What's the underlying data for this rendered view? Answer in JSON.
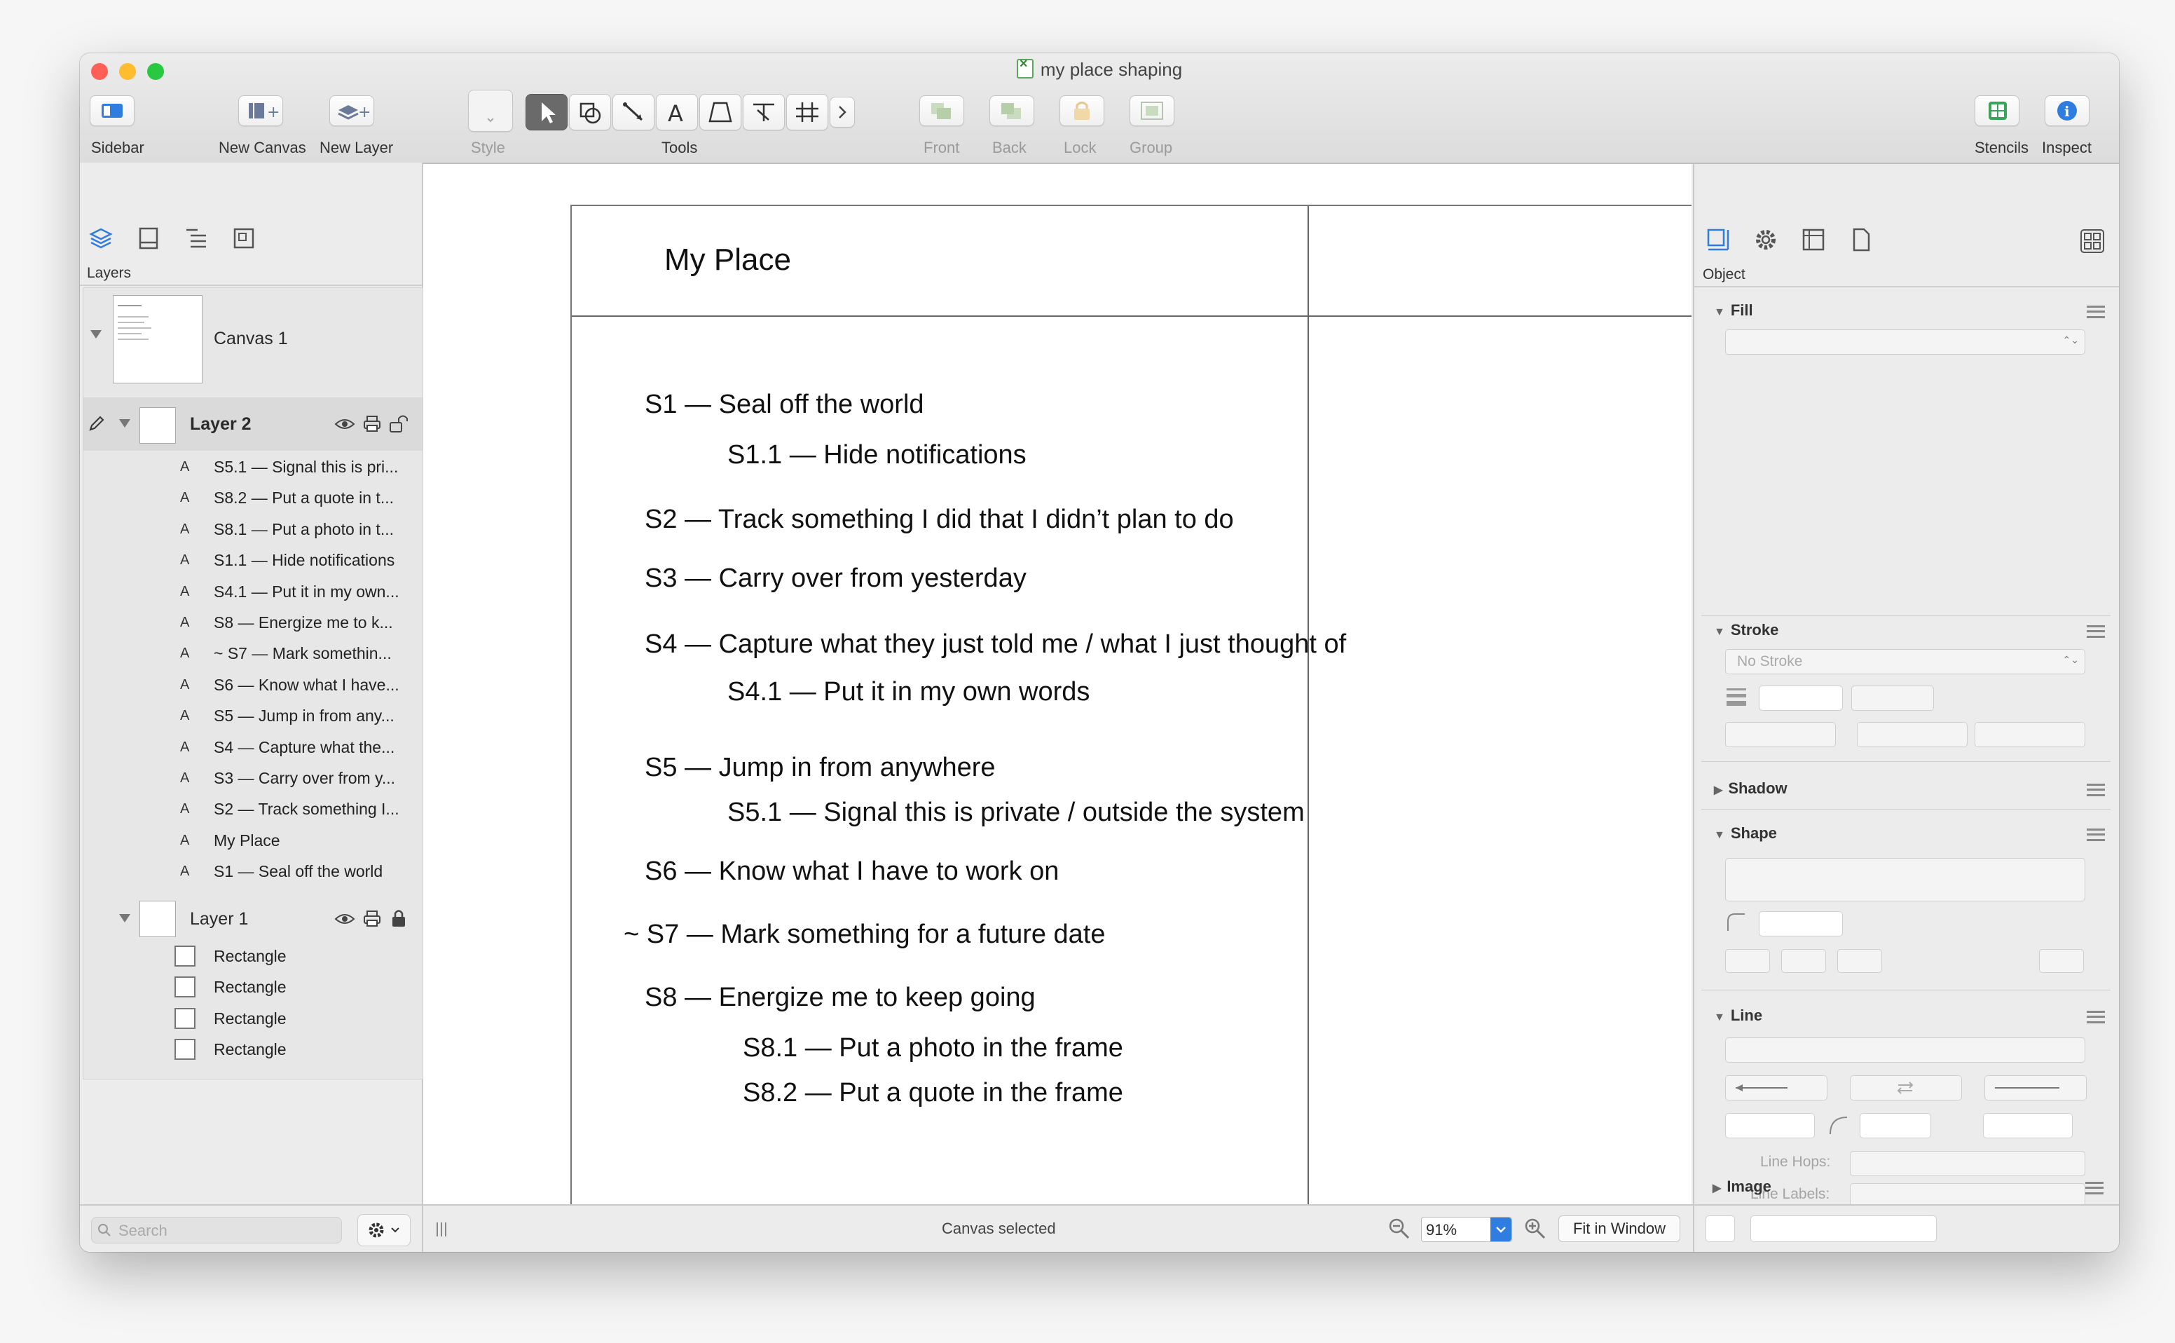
{
  "window": {
    "title": "my place shaping",
    "traffic_colors": [
      "#fe5f57",
      "#febc2e",
      "#28c840"
    ]
  },
  "toolbar": {
    "sidebar_label": "Sidebar",
    "new_canvas_label": "New Canvas",
    "new_layer_label": "New Layer",
    "style_label": "Style",
    "tools_label": "Tools",
    "front_label": "Front",
    "back_label": "Back",
    "lock_label": "Lock",
    "group_label": "Group",
    "stencils_label": "Stencils",
    "inspect_label": "Inspect",
    "tools": [
      "pointer-tool-icon",
      "shape-tool-icon",
      "line-tool-icon",
      "text-tool-icon",
      "pen-tool-icon",
      "point-editor-icon",
      "diagram-tool-icon",
      "more-tools-icon"
    ],
    "accent": "#2f7de1"
  },
  "sidebar": {
    "section_label": "Layers",
    "canvas_name": "Canvas 1",
    "layer2": {
      "name": "Layer 2",
      "items": [
        "S5.1 — Signal this is pri...",
        "S8.2 — Put a quote in t...",
        "S8.1 — Put a photo in t...",
        "S1.1 — Hide notifications",
        "S4.1 — Put it in my own...",
        "S8 — Energize me to k...",
        "~ S7 — Mark somethin...",
        "S6 — Know what I have...",
        "S5 — Jump in from any...",
        "S4 — Capture what the...",
        "S3 — Carry over from y...",
        "S2 — Track something I...",
        "My Place",
        "S1 — Seal off the world"
      ],
      "item_type_glyph": "A"
    },
    "layer1": {
      "name": "Layer 1",
      "items": [
        "Rectangle",
        "Rectangle",
        "Rectangle",
        "Rectangle"
      ]
    },
    "search_placeholder": "Search"
  },
  "canvas": {
    "title": "My Place",
    "lines": [
      "S1  —  Seal off the world",
      "S1.1  —  Hide notifications",
      "S2  —  Track something I did that I didn’t plan to do",
      "S3  —  Carry over from yesterday",
      "S4  —  Capture what they just told me / what I just thought of",
      "S4.1  —  Put it in my own words",
      "S5  —  Jump in from anywhere",
      "S5.1  —  Signal this is private / outside the system",
      "S6  —  Know what I have to work on",
      "~ S7  —  Mark something for a future date",
      "S8  —  Energize me to keep going",
      "S8.1  —  Put a photo in the frame",
      "S8.2  —  Put a quote in the frame"
    ]
  },
  "statusbar": {
    "status_text": "Canvas selected",
    "zoom_value": "91%",
    "fit_label": "Fit in Window"
  },
  "inspector": {
    "tab_label": "Object",
    "sections": {
      "fill": "Fill",
      "stroke": "Stroke",
      "stroke_value": "No Stroke",
      "shadow": "Shadow",
      "shape": "Shape",
      "line": "Line",
      "line_hops": "Line Hops:",
      "line_labels": "Line Labels:",
      "image": "Image"
    }
  }
}
